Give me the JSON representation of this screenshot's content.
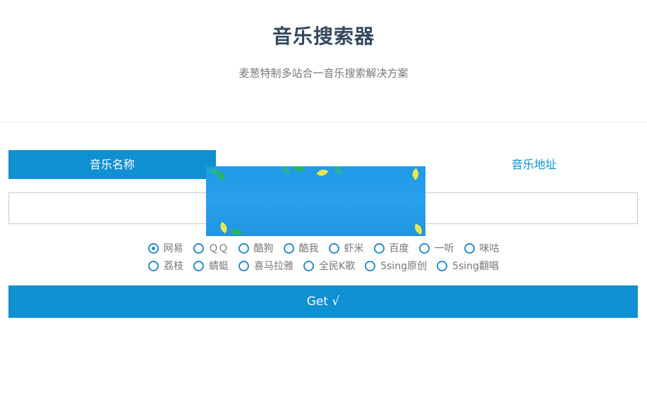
{
  "header": {
    "title": "音乐搜索器",
    "subtitle": "麦葱特制多站合一音乐搜索解决方案"
  },
  "tabs": [
    {
      "label": "音乐名称",
      "active": true
    },
    {
      "label": "音乐地址",
      "active": false
    }
  ],
  "search": {
    "value": "",
    "placeholder": ""
  },
  "sources": {
    "row1": [
      {
        "label": "网易",
        "checked": true
      },
      {
        "label": "ＱＱ",
        "checked": false
      },
      {
        "label": "酷狗",
        "checked": false
      },
      {
        "label": "酷我",
        "checked": false
      },
      {
        "label": "虾米",
        "checked": false
      },
      {
        "label": "百度",
        "checked": false
      },
      {
        "label": "一听",
        "checked": false
      },
      {
        "label": "咪咕",
        "checked": false
      }
    ],
    "row2": [
      {
        "label": "荔枝",
        "checked": false
      },
      {
        "label": "蜻蜓",
        "checked": false
      },
      {
        "label": "喜马拉雅",
        "checked": false
      },
      {
        "label": "全民K歌",
        "checked": false
      },
      {
        "label": "5sing原创",
        "checked": false
      },
      {
        "label": "5sing翻唱",
        "checked": false
      }
    ]
  },
  "actions": {
    "get_label": "Get √"
  },
  "colors": {
    "accent": "#0e90d2",
    "title": "#34495e",
    "muted": "#777777",
    "radio": "#2a8dc7"
  }
}
